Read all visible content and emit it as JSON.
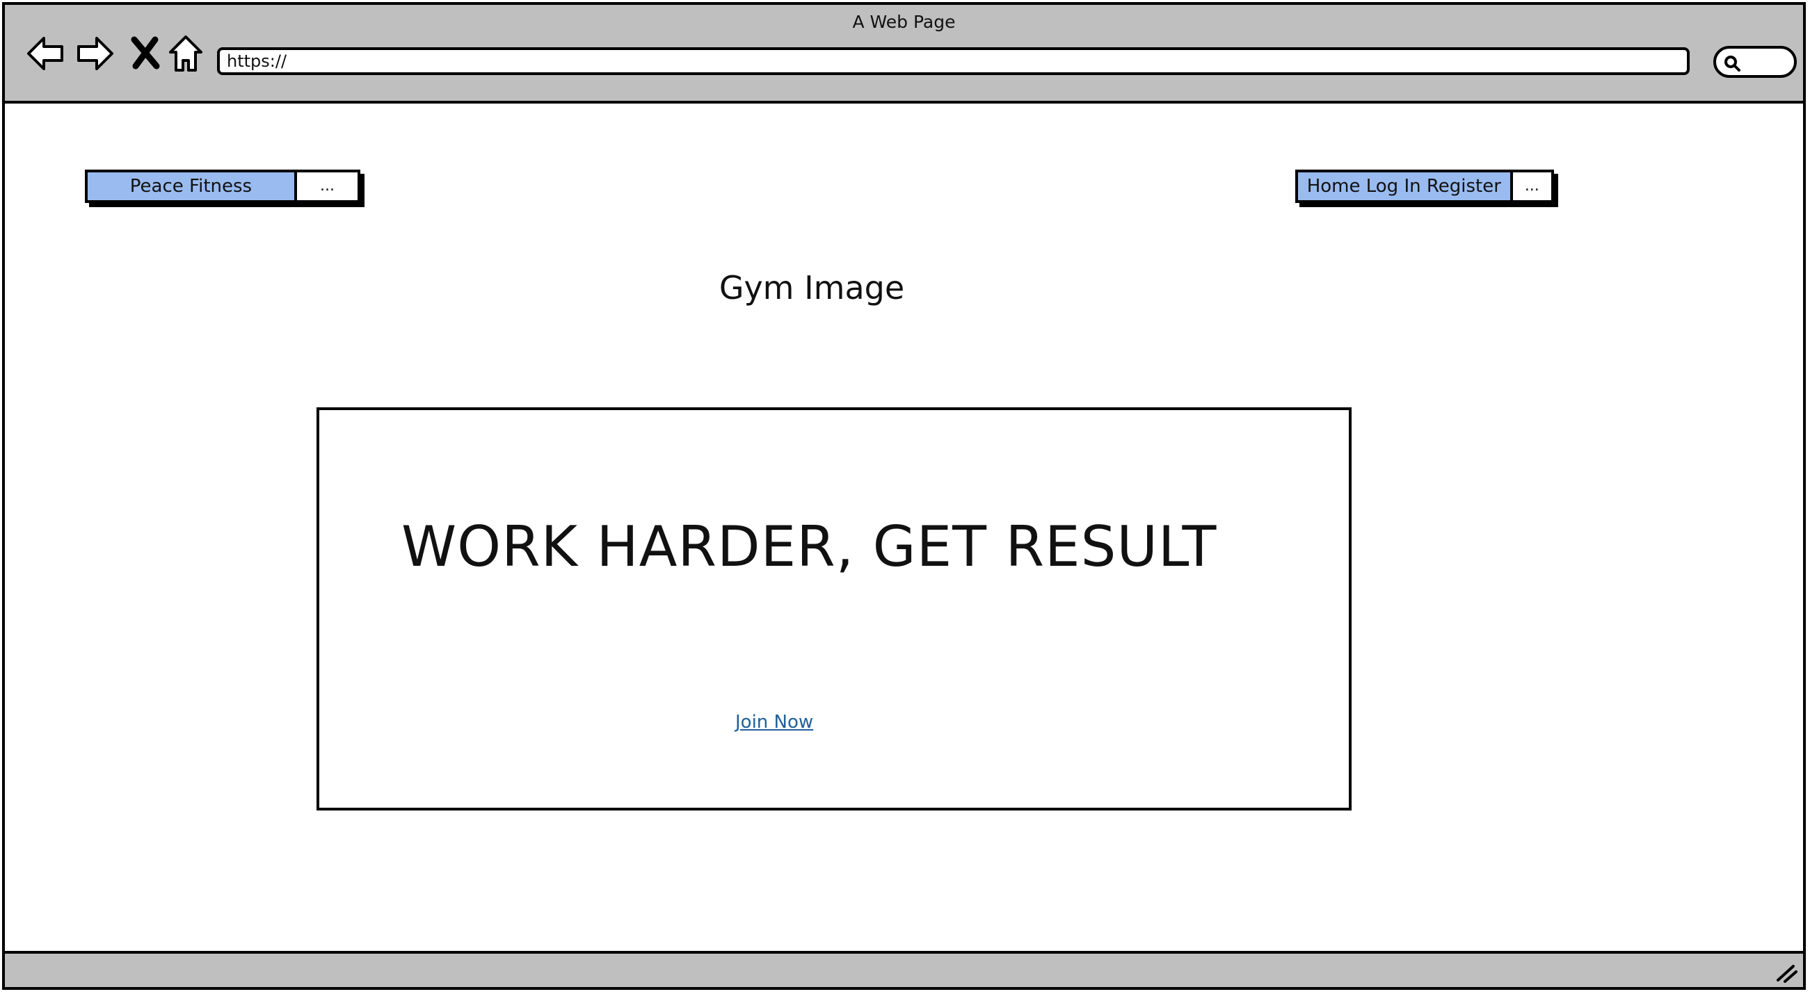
{
  "browser": {
    "window_title": "A Web Page",
    "url": "https://",
    "icons": [
      "back-arrow-icon",
      "forward-arrow-icon",
      "stop-icon",
      "home-icon",
      "search-icon",
      "resize-grip-icon"
    ]
  },
  "brand": {
    "label": "Peace Fitness",
    "more_label": "..."
  },
  "nav": {
    "label": "Home Log In Register",
    "more_label": "..."
  },
  "main": {
    "image_placeholder": "Gym Image",
    "hero_title": "WORK HARDER, GET RESULT",
    "cta_link": "Join Now"
  },
  "colors": {
    "chrome_gray": "#bfbfbf",
    "button_blue": "#99bbf0",
    "link_blue": "#1f5f99"
  }
}
